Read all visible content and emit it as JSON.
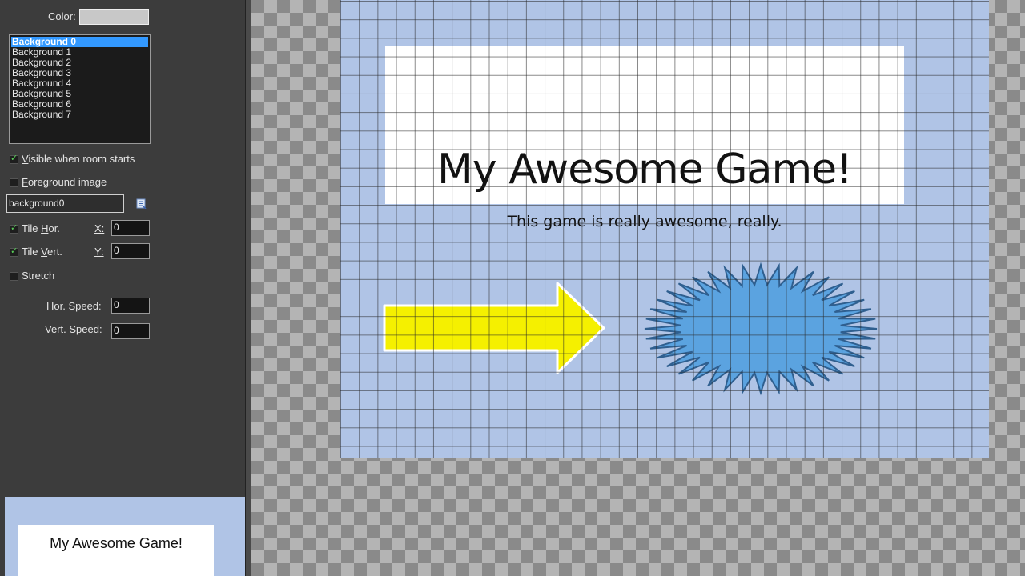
{
  "panel": {
    "color_label": "Color:",
    "backgrounds": [
      "Background 0",
      "Background 1",
      "Background 2",
      "Background 3",
      "Background 4",
      "Background 5",
      "Background 6",
      "Background 7"
    ],
    "selected_index": 0,
    "visible_label_u": "V",
    "visible_label_rest": "isible when room starts",
    "visible_checked": true,
    "foreground_label_u": "F",
    "foreground_label_rest": "oreground image",
    "foreground_checked": false,
    "background_name": "background0",
    "tile_hor_label_a": "Tile ",
    "tile_hor_label_u": "H",
    "tile_hor_label_b": "or.",
    "tile_hor_checked": true,
    "tile_vert_label_a": "Tile ",
    "tile_vert_label_u": "V",
    "tile_vert_label_b": "ert.",
    "tile_vert_checked": true,
    "x_label": "X:",
    "x_value": "0",
    "y_label": "Y:",
    "y_value": "0",
    "stretch_label": "Stretch",
    "stretch_checked": false,
    "hor_speed_label": "Hor. Speed:",
    "hor_speed_value": "0",
    "vert_speed_label_a": "V",
    "vert_speed_label_u": "e",
    "vert_speed_label_b": "rt. Speed:",
    "vert_speed_value": "0",
    "preview_title": "My Awesome Game!"
  },
  "room": {
    "title": "My Awesome Game!",
    "subtitle": "This game is really awesome, really.",
    "arrow_color": "#f5f000",
    "starburst_color": "#5ba3e0",
    "background_color": "#b0c4e6"
  }
}
